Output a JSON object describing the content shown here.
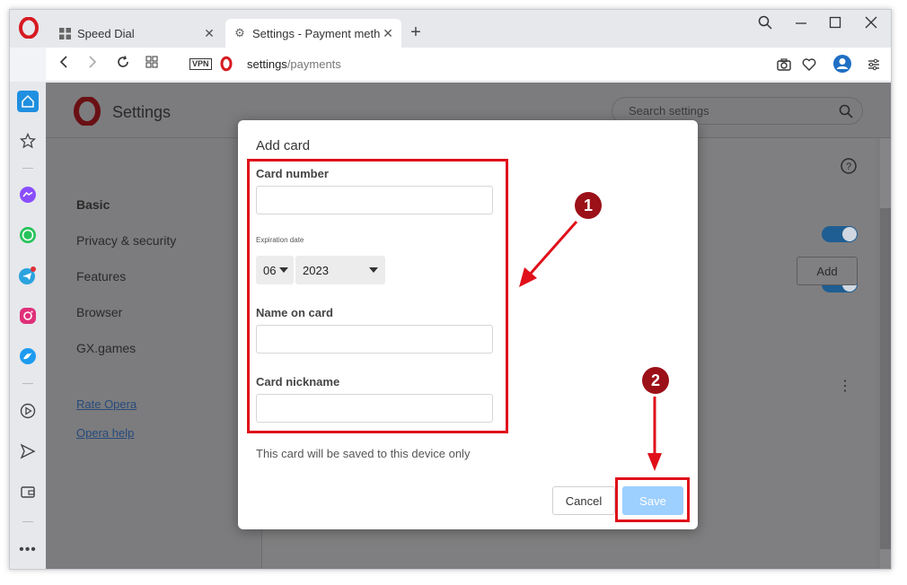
{
  "browser": {
    "tabs": [
      {
        "title": "Speed Dial",
        "icon": "grid-icon",
        "active": false
      },
      {
        "title": "Settings - Payment metho",
        "icon": "gear-icon",
        "active": true
      }
    ],
    "address": {
      "vpn_label": "VPN",
      "url_host": "settings",
      "url_path": "/payments"
    }
  },
  "settings": {
    "title": "Settings",
    "search_placeholder": "Search settings",
    "nav": [
      {
        "label": "Basic",
        "bold": true
      },
      {
        "label": "Privacy & security"
      },
      {
        "label": "Features"
      },
      {
        "label": "Browser"
      },
      {
        "label": "GX.games"
      }
    ],
    "links": [
      "Rate Opera",
      "Opera help"
    ],
    "add_button": "Add",
    "toggles_on": [
      true,
      true
    ]
  },
  "dialog": {
    "title": "Add card",
    "card_number_label": "Card number",
    "card_number_value": "",
    "expiration_label": "Expiration date",
    "exp_month": "06",
    "exp_year": "2023",
    "name_label": "Name on card",
    "name_value": "",
    "nickname_label": "Card nickname",
    "nickname_value": "",
    "note": "This card will be saved to this device only",
    "cancel_label": "Cancel",
    "save_label": "Save"
  },
  "annotations": {
    "step1": "1",
    "step2": "2",
    "color": "#e0101a",
    "badge_color": "#9c1018"
  },
  "colors": {
    "accent": "#1f5e92",
    "save_disabled": "#9dcfff",
    "opera_red": "#d71a21"
  }
}
